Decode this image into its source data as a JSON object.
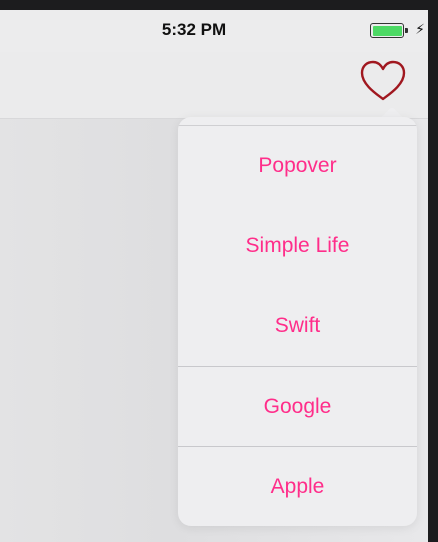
{
  "status_bar": {
    "time": "5:32 PM",
    "charging_glyph": "⚡",
    "battery_color": "#4cd964"
  },
  "nav_bar": {
    "heart_icon": "heart-icon",
    "heart_color": "#a0171f"
  },
  "popover": {
    "items": [
      {
        "label": "Popover"
      },
      {
        "label": "Simple Life"
      },
      {
        "label": "Swift"
      },
      {
        "label": "Google"
      },
      {
        "label": "Apple"
      }
    ],
    "accent_color": "#ff2d8a"
  }
}
